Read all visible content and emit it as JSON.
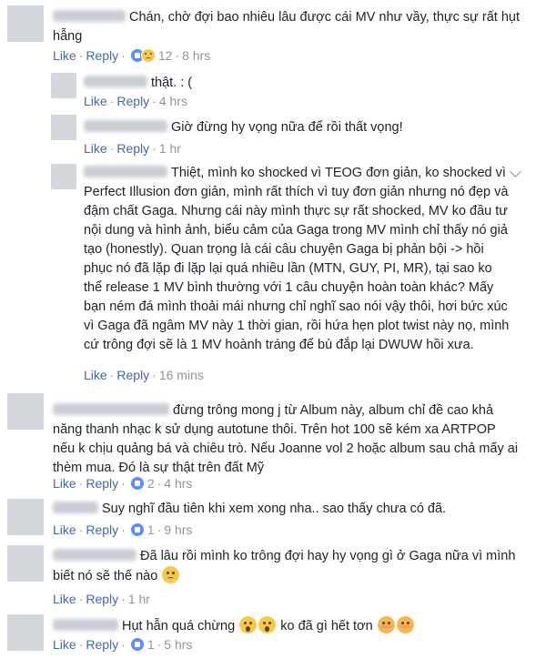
{
  "actions": {
    "like": "Like",
    "reply": "Reply",
    "separator": "·"
  },
  "colors": {
    "link": "#4267b2",
    "meta": "#90949c",
    "text": "#1d2129"
  },
  "comments": [
    {
      "text": "Chán, chờ đợi bao nhiêu lâu được cái MV như vầy, thực sự rất hụt hẫng",
      "reactions": "12",
      "time": "8 hrs"
    },
    {
      "text": "thật. : (",
      "time": "4 hrs"
    },
    {
      "text": "Giờ đừng hy vọng nữa để rồi thất vọng!",
      "time": "1 hr"
    },
    {
      "text": "Thiệt, mình ko shocked vì TEOG đơn giản, ko shocked vì Perfect Illusion đơn giản, mình rất thích vì tuy đơn giản nhưng nó đẹp và đậm chất Gaga. Nhưng cái này mình thực sự rất shocked, MV ko đầu tư nội dung và hình ảnh, biểu cảm của Gaga trong MV mình chỉ thấy nó giả tạo (honestly). Quan trọng là cái câu chuyện Gaga bị phản bội -> hồi phục nó đã lặp đi lặp lại quá nhiều lần (MTN, GUY, PI, MR), tại sao ko thể release 1 MV bình thường với 1 câu chuyện hoàn toàn khác? Mấy bạn ném đá mình thoải mái nhưng chỉ nghĩ sao nói vậy thôi, hơi bức xúc vì Gaga đã ngâm MV này 1 thời gian, rồi hứa hẹn plot twist này nọ, mình cứ trông đợi sẽ là 1 MV hoành tráng để bù đắp lại DWUW hồi xưa.",
      "time": "16 mins"
    },
    {
      "text": "đừng trông mong j từ Album này, album chỉ đề cao khả năng thanh nhạc k sử dụng autotune thôi. Trên hot 100 sẽ kém xa ARTPOP nếu k chịu quảng bá và chiêu trò. Nếu Joanne vol 2 hoặc album sau chả mấy ai thèm mua. Đó là sự thật trên đất Mỹ",
      "reactions": "2",
      "time": "4 hrs"
    },
    {
      "text": "Suy nghĩ đầu tiên khi xem xong nha.. sao thấy chưa có đã.",
      "reactions": "1",
      "time": "9 hrs"
    },
    {
      "text": "Đã lâu rồi mình ko trông đợi hay hy vọng gì ở Gaga nữa vì mình biết nó sẽ thế nào",
      "time": "1 hr"
    },
    {
      "text_a": "Hụt hẫn quá chừng",
      "text_b": "ko đã gì hết tơn",
      "reactions": "1",
      "time": "5 hrs"
    }
  ]
}
